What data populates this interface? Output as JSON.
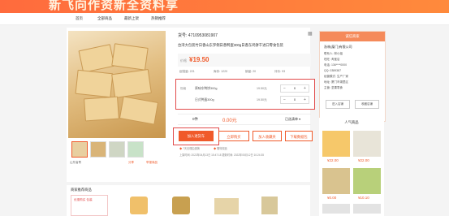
{
  "banner": {
    "headline": "新飞向作资新全资料享"
  },
  "nav": {
    "items": [
      "首页",
      "全部商品",
      "最新上架",
      "热销推荐"
    ]
  },
  "product": {
    "sku_label": "货号: 4710953081907",
    "name": "台湾大包装竹日香山东罗俐日香鸭蛋300g日香东鸡饼干进口零食包装",
    "price_label": "价格",
    "price": "¥19.50",
    "stats": [
      "起批量: 221",
      "库存: 1220",
      "销量: 20",
      "评价: 93"
    ],
    "spec_title": "规格",
    "specs": [
      {
        "name": "原味东鸭饼300g",
        "price": "19.50元",
        "qty": "0"
      },
      {
        "name": "日式鸭蛋300g",
        "price": "19.50元",
        "qty": "0"
      }
    ],
    "total_qty": "0件",
    "total_price": "0.00元",
    "selected_label": "已选清单 ▾",
    "buttons": {
      "cart": "加入进货车",
      "buy": "立即购买",
      "favorite": "加入收藏夹",
      "download": "下载数据包"
    },
    "service_text": "7天无理由退换",
    "service_text2": "赠特权品",
    "meta_line": "上架时间: 2022年04月13日 15:47:18    更新时间: 2022年05月12日 10:24:35",
    "under_left": "山东省青",
    "under_links": [
      "分享",
      "举报商品"
    ]
  },
  "shop": {
    "header": "诚信商家",
    "lines": [
      "浙林(厦门)有限公司",
      "联系人: 林小姐",
      "旺旺: 淘宝店",
      "电话: 136****0000",
      "QQ: 0389387",
      "经营模式: 生产厂家",
      "地址: 厦门市湖里区",
      "主营: 坚果零食"
    ],
    "btn_enter": "进入店铺",
    "btn_fav": "收藏店铺"
  },
  "hot": {
    "title": "人气商品",
    "items": [
      {
        "price": "¥22.00"
      },
      {
        "price": "¥22.00"
      },
      {
        "price": "¥0.00"
      },
      {
        "price": "¥10.10"
      }
    ]
  },
  "recommend": {
    "title": "商家推荐商品",
    "tag": "优惠购买 包装"
  }
}
